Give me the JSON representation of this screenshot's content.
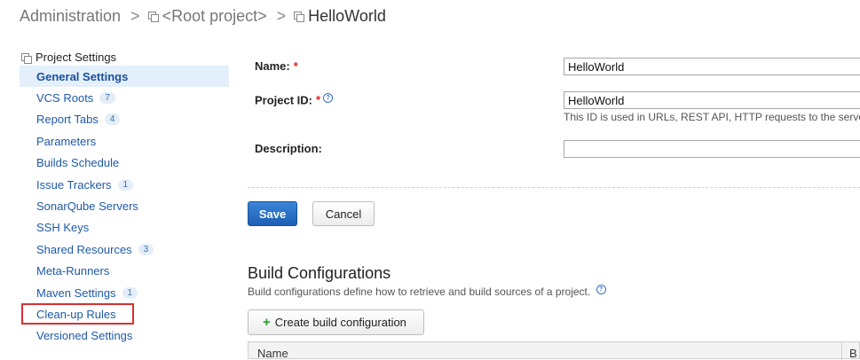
{
  "breadcrumb": {
    "items": [
      "Administration",
      "<Root project>"
    ],
    "current": "HelloWorld",
    "separator": ">"
  },
  "sidebar": {
    "section_title": "Project Settings",
    "items": [
      {
        "label": "General Settings",
        "count": null
      },
      {
        "label": "VCS Roots",
        "count": "7"
      },
      {
        "label": "Report Tabs",
        "count": "4"
      },
      {
        "label": "Parameters",
        "count": null
      },
      {
        "label": "Builds Schedule",
        "count": null
      },
      {
        "label": "Issue Trackers",
        "count": "1"
      },
      {
        "label": "SonarQube Servers",
        "count": null
      },
      {
        "label": "SSH Keys",
        "count": null
      },
      {
        "label": "Shared Resources",
        "count": "3"
      },
      {
        "label": "Meta-Runners",
        "count": null
      },
      {
        "label": "Maven Settings",
        "count": "1"
      },
      {
        "label": "Clean-up Rules",
        "count": null
      },
      {
        "label": "Versioned Settings",
        "count": null
      }
    ]
  },
  "form": {
    "name_label": "Name:",
    "required_mark": "*",
    "name_value": "HelloWorld",
    "project_id_label": "Project ID:",
    "help_glyph": "?",
    "project_id_value": "HelloWorld",
    "project_id_note": "This ID is used in URLs, REST API, HTTP requests to the server",
    "description_label": "Description:",
    "description_value": "",
    "save_label": "Save",
    "cancel_label": "Cancel"
  },
  "build_configurations": {
    "title": "Build Configurations",
    "description": "Build configurations define how to retrieve and build sources of a project.",
    "create_label": "Create build configuration",
    "plus_glyph": "+",
    "columns": [
      "Name",
      "B"
    ]
  },
  "colors": {
    "accent": "#1d5fb4",
    "link": "#1e5aa7",
    "active_bg": "#e3effb",
    "highlight_border": "#d93030"
  }
}
